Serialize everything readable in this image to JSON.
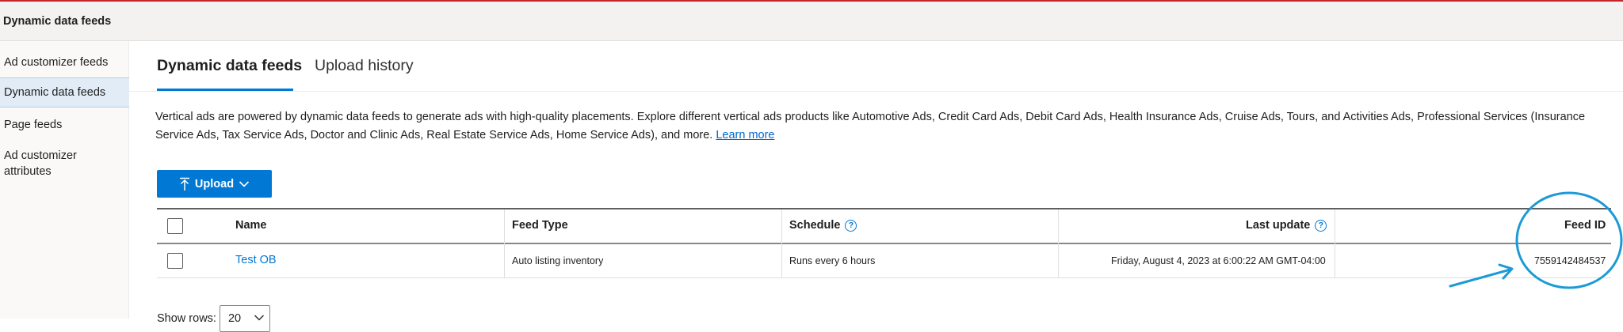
{
  "header": {
    "title": "Dynamic data feeds"
  },
  "sidebar": {
    "items": [
      {
        "label": "Ad customizer feeds",
        "active": false
      },
      {
        "label": "Dynamic data feeds",
        "active": true
      },
      {
        "label": "Page feeds",
        "active": false
      },
      {
        "label": "Ad customizer",
        "label2": "attributes",
        "active": false
      }
    ]
  },
  "tabs": [
    {
      "label": "Dynamic data feeds",
      "active": true
    },
    {
      "label": "Upload history",
      "active": false
    }
  ],
  "description": {
    "text": "Vertical ads are powered by dynamic data feeds to generate ads with high-quality placements. Explore different vertical ads products like Automotive Ads, Credit Card Ads, Debit Card Ads, Health Insurance Ads, Cruise Ads, Tours, and Activities Ads, Professional Services (Insurance Service Ads, Tax Service Ads, Doctor and Clinic Ads, Real Estate Service Ads, Home Service Ads), and more.",
    "link": "Learn more"
  },
  "toolbar": {
    "upload_label": "Upload"
  },
  "table": {
    "columns": {
      "name": "Name",
      "feed_type": "Feed Type",
      "schedule": "Schedule",
      "last_update": "Last update",
      "feed_id": "Feed ID"
    },
    "rows": [
      {
        "name": "Test OB",
        "feed_type": "Auto listing inventory",
        "schedule": "Runs every 6 hours",
        "last_update": "Friday, August 4, 2023 at 6:00:22 AM GMT-04:00",
        "feed_id": "7559142484537"
      }
    ]
  },
  "pagination": {
    "show_rows_label": "Show rows:",
    "rows_value": "20"
  },
  "colors": {
    "accent": "#0078d4",
    "annotation": "#1a9ad6",
    "topline": "#c4262e"
  }
}
